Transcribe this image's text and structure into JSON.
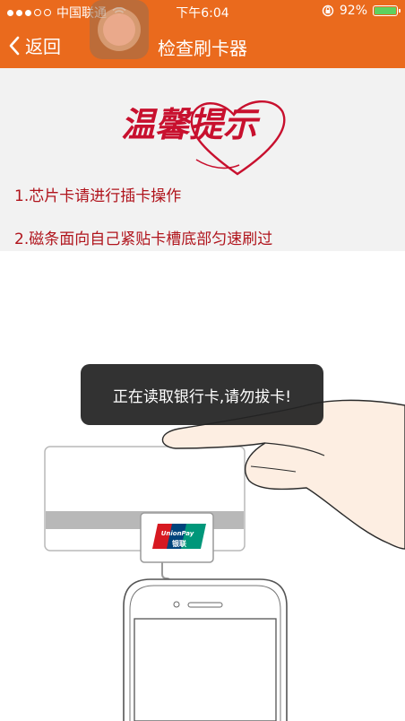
{
  "status_bar": {
    "carrier": "中国联通",
    "time": "下午6:04",
    "battery_percent": "92%",
    "battery_level": 0.92
  },
  "nav": {
    "back_label": "返回",
    "title": "检查刷卡器"
  },
  "tips": {
    "heading": "温馨提示",
    "items": [
      "1.芯片卡请进行插卡操作",
      "2.磁条面向自己紧贴卡槽底部匀速刷过"
    ]
  },
  "toast": "正在读取银行卡,请勿拔卡!",
  "card": {
    "logo_text": "UnionPay",
    "logo_cn": "银联"
  },
  "colors": {
    "header": "#ea6a1d",
    "tip_text": "#b0141c",
    "heading": "#c8102e"
  }
}
